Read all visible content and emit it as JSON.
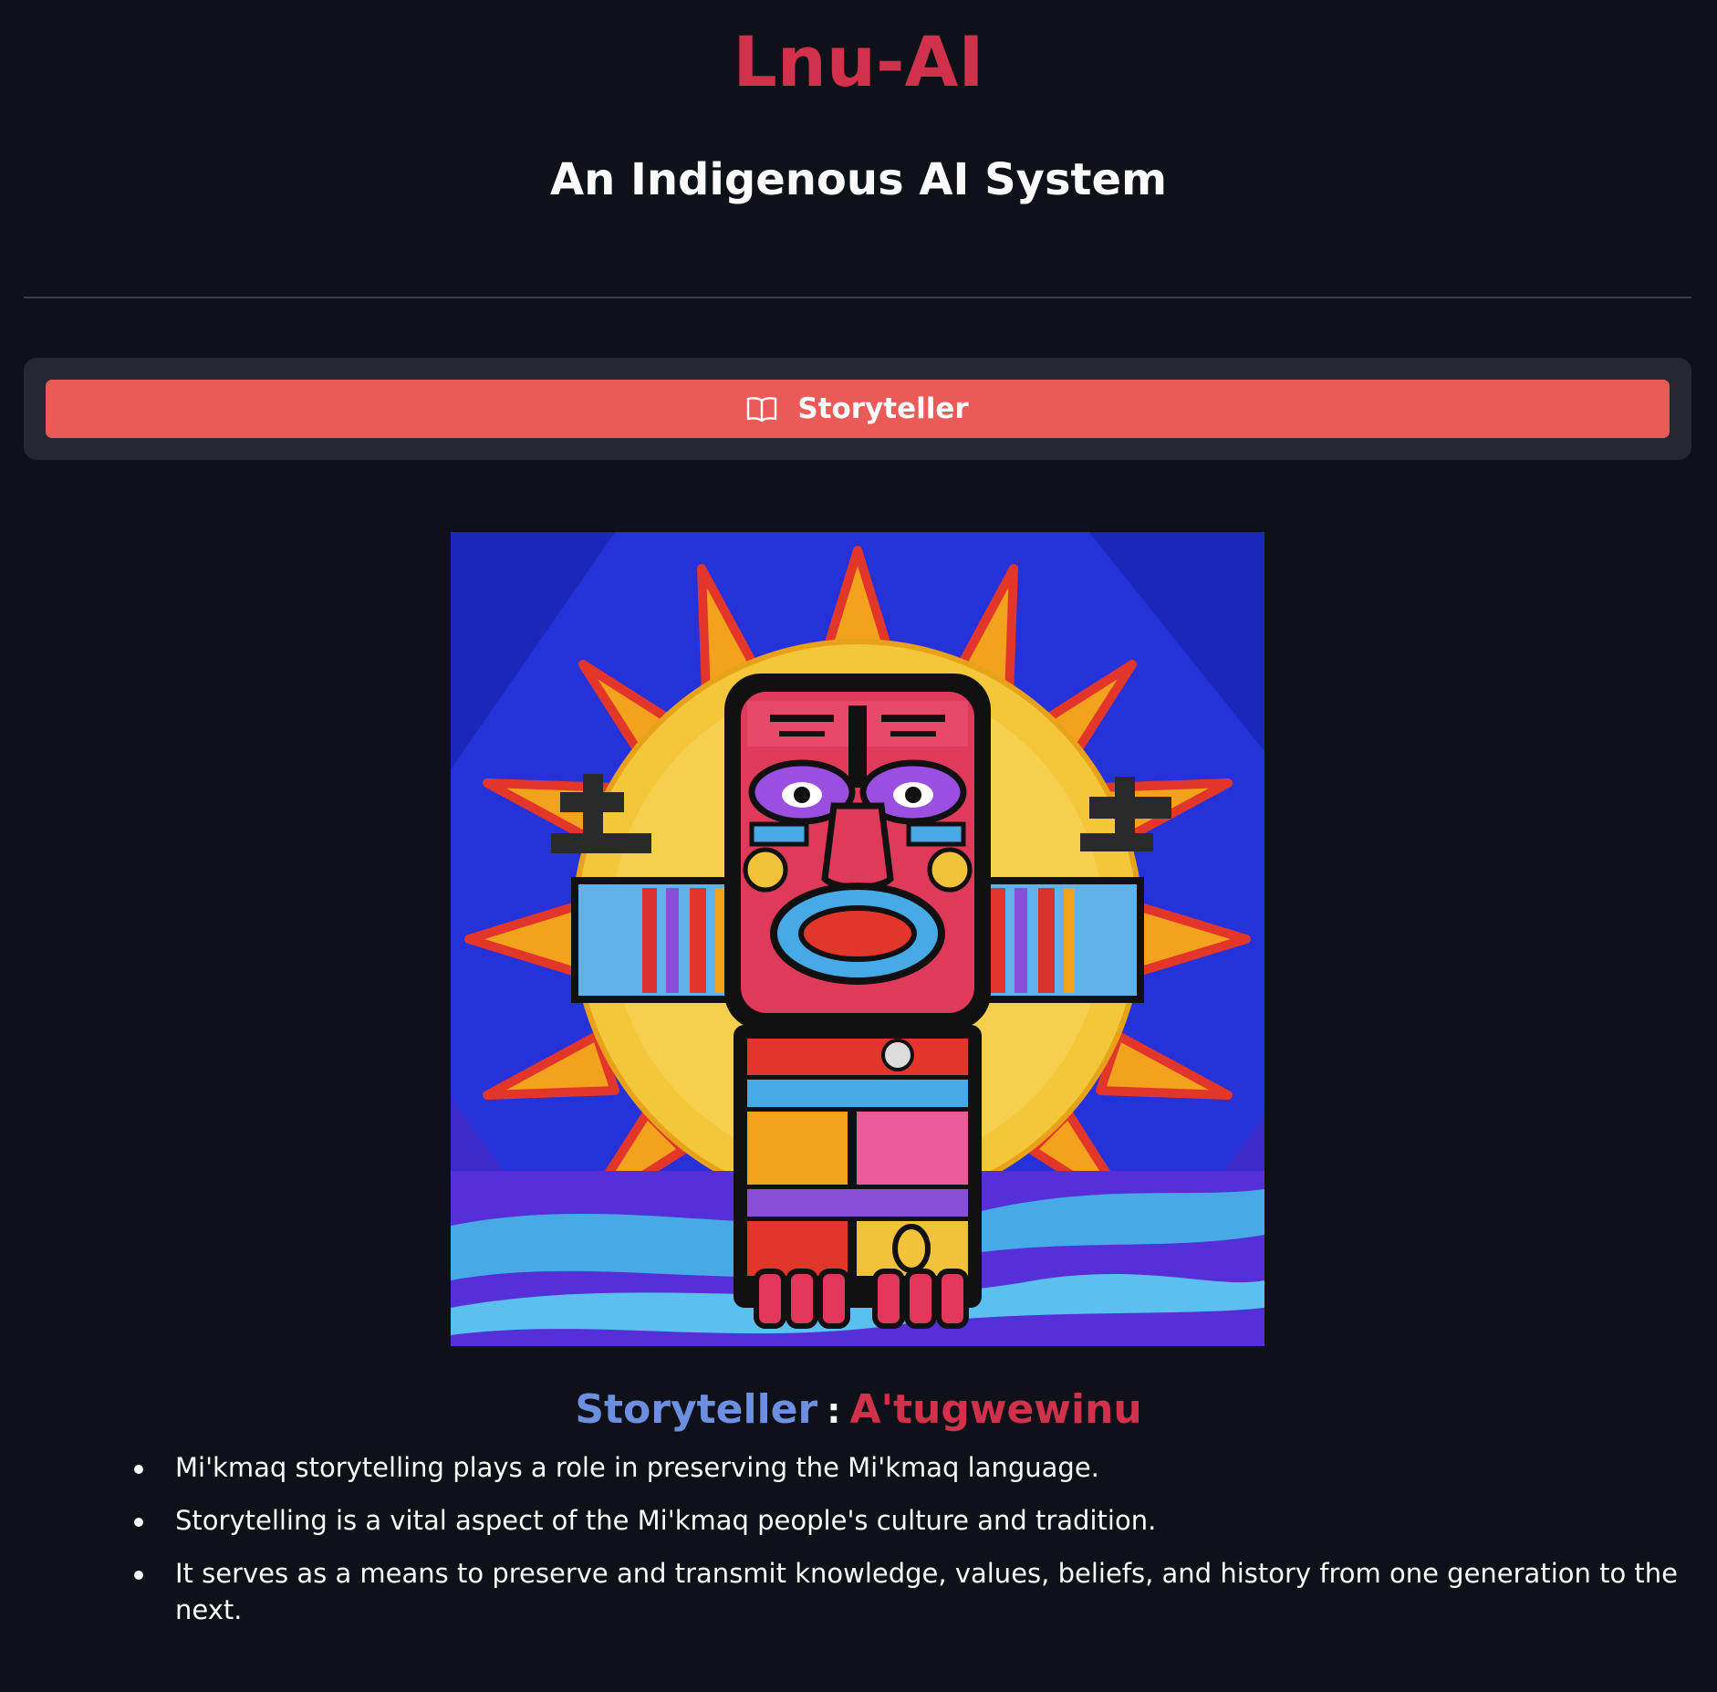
{
  "app": {
    "title": "Lnu-AI",
    "subtitle": "An Indigenous AI System"
  },
  "menu": {
    "button_label": "Storyteller",
    "button_icon": "book-icon"
  },
  "artwork": {
    "description_icon": "totem-figure-sun-image"
  },
  "section": {
    "title_english": "Storyteller",
    "separator": ":",
    "title_mikmaq": "A'tugwewinu",
    "facts": [
      "Mi'kmaq storytelling plays a role in preserving the Mi'kmaq language.",
      "Storytelling is a vital aspect of the Mi'kmaq people's culture and tradition.",
      "It serves as a means to preserve and transmit knowledge, values, beliefs, and history from one generation to the next."
    ]
  },
  "colors": {
    "background": "#0e1117",
    "accent_red": "#d1314a",
    "button": "#ea5b57",
    "heading_blue": "#6c8fe0",
    "container": "#262730"
  }
}
